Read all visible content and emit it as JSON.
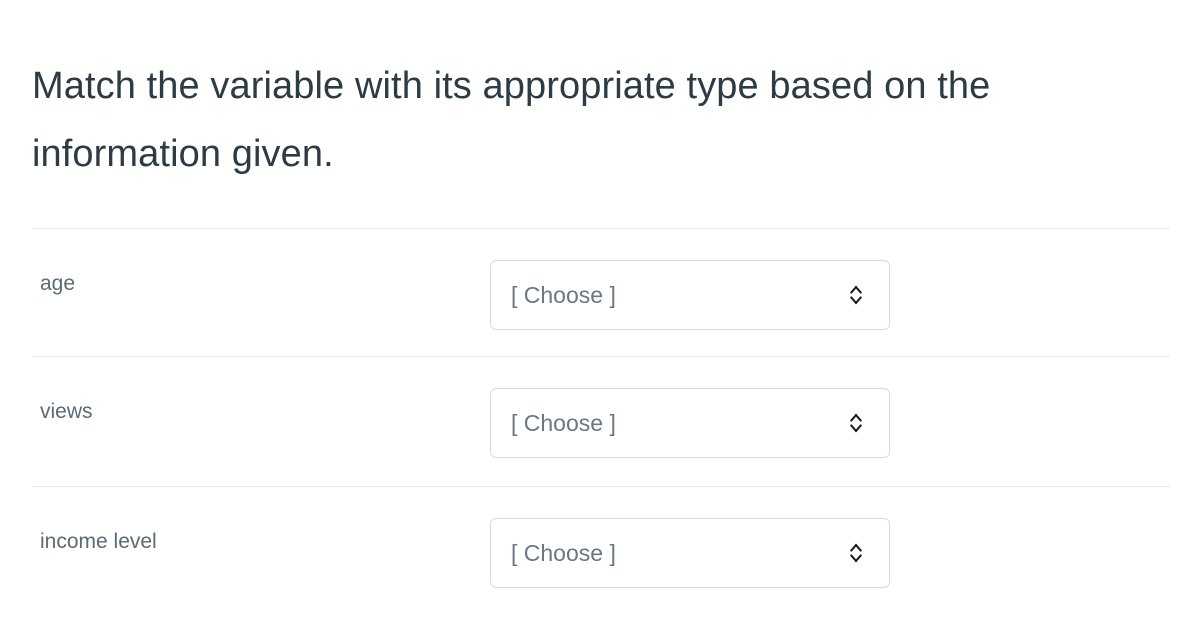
{
  "question": {
    "prompt": "Match the variable with its appropriate type based on the information given."
  },
  "matching": {
    "select_indicator_icon": "updown-chevron-icon",
    "rows": [
      {
        "label": "age",
        "selected": "[ Choose ]",
        "placeholder": "[ Choose ]"
      },
      {
        "label": "views",
        "selected": "[ Choose ]",
        "placeholder": "[ Choose ]"
      },
      {
        "label": "income level",
        "selected": "[ Choose ]",
        "placeholder": "[ Choose ]"
      }
    ]
  },
  "theme": {
    "background": "#ffffff",
    "heading_color": "#2d3b45",
    "label_color": "#5d6a73",
    "placeholder_color": "#6b7780",
    "border_color": "#d6d9dc",
    "divider_color": "#e8eaec"
  }
}
